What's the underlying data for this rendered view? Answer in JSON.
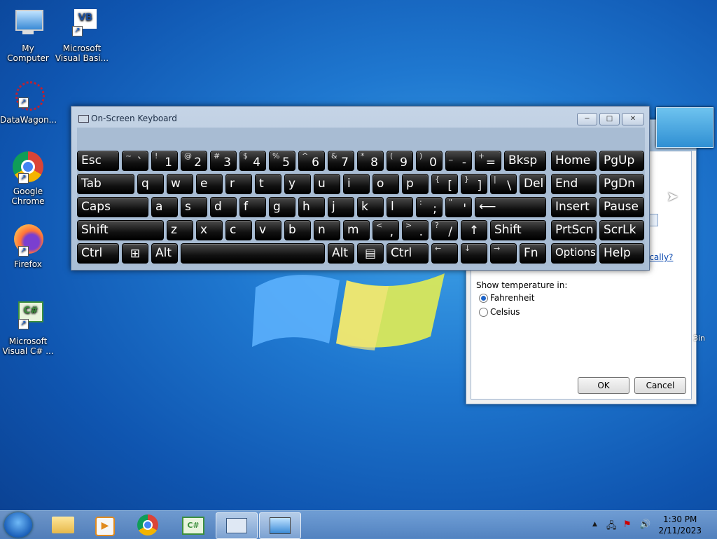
{
  "desktop": {
    "icons": [
      {
        "label": "My Computer"
      },
      {
        "label": "Microsoft Visual Basi..."
      },
      {
        "label": "DataWagon..."
      },
      {
        "label": "Google Chrome"
      },
      {
        "label": "Firefox"
      },
      {
        "label": "Microsoft Visual C# ..."
      }
    ]
  },
  "weather_dialog": {
    "link_fragment": "ically?",
    "side_text": "3in",
    "show_temp_label": "Show temperature in:",
    "option_fahrenheit": "Fahrenheit",
    "option_celsius": "Celsius",
    "selected": "Fahrenheit",
    "ok": "OK",
    "cancel": "Cancel"
  },
  "osk": {
    "title": "On-Screen Keyboard",
    "minimize": "−",
    "maximize": "□",
    "close": "✕",
    "keys": {
      "esc": "Esc",
      "tilde_top": "~",
      "tilde_bot": "`",
      "n1_top": "!",
      "n1": "1",
      "n2_top": "@",
      "n2": "2",
      "n3_top": "#",
      "n3": "3",
      "n4_top": "$",
      "n4": "4",
      "n5_top": "%",
      "n5": "5",
      "n6_top": "^",
      "n6": "6",
      "n7_top": "&",
      "n7": "7",
      "n8_top": "*",
      "n8": "8",
      "n9_top": "(",
      "n9": "9",
      "n0_top": ")",
      "n0": "0",
      "minus_top": "_",
      "minus": "-",
      "eq_top": "+",
      "eq": "=",
      "bksp": "Bksp",
      "home": "Home",
      "pgup": "PgUp",
      "tab": "Tab",
      "q": "q",
      "w": "w",
      "e": "e",
      "r": "r",
      "t": "t",
      "y": "y",
      "u": "u",
      "i": "i",
      "o": "o",
      "p": "p",
      "lbr_top": "{",
      "lbr": "[",
      "rbr_top": "}",
      "rbr": "]",
      "bs_top": "|",
      "bs": "\\",
      "del": "Del",
      "end": "End",
      "pgdn": "PgDn",
      "caps": "Caps",
      "a": "a",
      "s": "s",
      "d": "d",
      "f": "f",
      "g": "g",
      "h": "h",
      "j": "j",
      "k": "k",
      "l": "l",
      "semi_top": ":",
      "semi": ";",
      "quote_top": "\"",
      "quote": "'",
      "enter": "⟵",
      "insert": "Insert",
      "pause": "Pause",
      "shift": "Shift",
      "z": "z",
      "x": "x",
      "c": "c",
      "v": "v",
      "b": "b",
      "n": "n",
      "m": "m",
      "comma_top": "<",
      "comma": ",",
      "dot_top": ">",
      "dot": ".",
      "slash_top": "?",
      "slash": "/",
      "up": "↑",
      "shift_r": "Shift",
      "prtscn": "PrtScn",
      "scrlk": "ScrLk",
      "ctrl": "Ctrl",
      "win": "⊞",
      "alt": "Alt",
      "alt_r": "Alt",
      "menu": "▤",
      "ctrl_r": "Ctrl",
      "left": "←",
      "down": "↓",
      "right": "→",
      "fn": "Fn",
      "options": "Options",
      "help": "Help"
    }
  },
  "taskbar": {
    "time": "1:30 PM",
    "date": "2/11/2023",
    "tray_arrow": "▲"
  }
}
